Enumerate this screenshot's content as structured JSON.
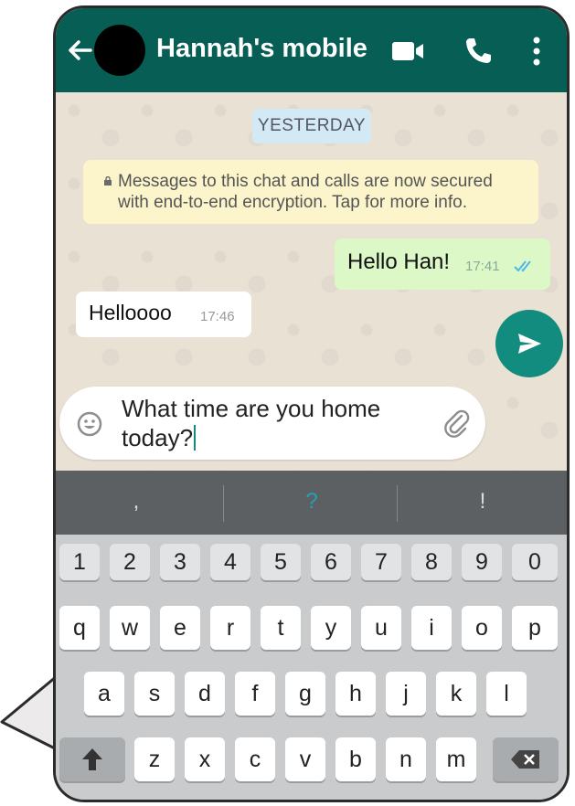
{
  "header": {
    "title": "Hannah's mobile",
    "back_icon": "arrow-left-icon",
    "video_icon": "video-camera-icon",
    "call_icon": "phone-icon",
    "menu_icon": "more-vertical-icon",
    "color": "#075e54"
  },
  "chat": {
    "date_chip": "YESTERDAY",
    "encryption_notice": "Messages to this chat and calls are now secured with end-to-end encryption. Tap for more info.",
    "messages": [
      {
        "direction": "outgoing",
        "text": "Hello Han!",
        "time": "17:41",
        "status": "read"
      },
      {
        "direction": "incoming",
        "text": "Helloooo",
        "time": "17:46"
      }
    ]
  },
  "composer": {
    "text": "What time are you home today?",
    "emoji_icon": "emoji-icon",
    "attach_icon": "paperclip-icon",
    "send_icon": "send-icon",
    "accent": "#128c7e"
  },
  "suggestions": [
    ",",
    "?",
    "!"
  ],
  "keyboard": {
    "numbers": [
      "1",
      "2",
      "3",
      "4",
      "5",
      "6",
      "7",
      "8",
      "9",
      "0"
    ],
    "row1": [
      "q",
      "w",
      "e",
      "r",
      "t",
      "y",
      "u",
      "i",
      "o",
      "p"
    ],
    "row2": [
      "a",
      "s",
      "d",
      "f",
      "g",
      "h",
      "j",
      "k",
      "l"
    ],
    "row3": [
      "z",
      "x",
      "c",
      "v",
      "b",
      "n",
      "m"
    ],
    "shift_icon": "shift-arrow-icon",
    "backspace_icon": "backspace-icon"
  }
}
